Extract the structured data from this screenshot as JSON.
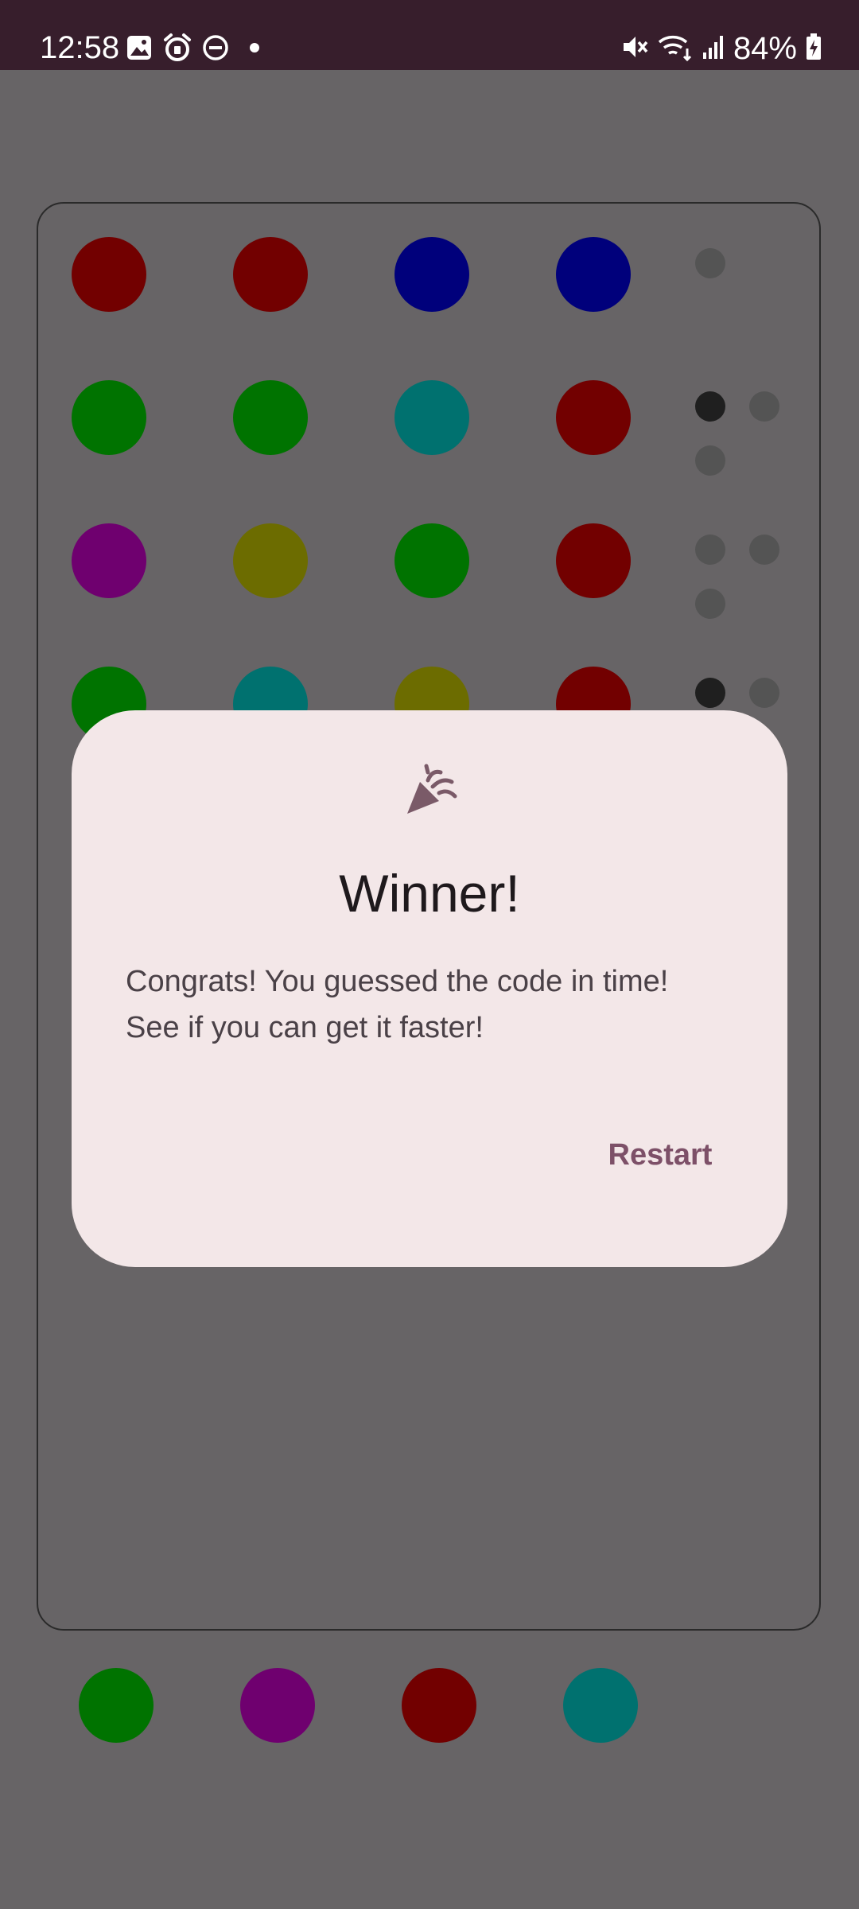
{
  "status_bar": {
    "time": "12:58",
    "battery": "84%",
    "left_icons": [
      "image-icon",
      "alarm-icon",
      "dnd-icon",
      "dot-icon"
    ],
    "right_icons": [
      "mute-icon",
      "wifi-icon",
      "signal-icon",
      "battery-icon"
    ]
  },
  "board": {
    "rows": [
      {
        "pegs": [
          "#720000",
          "#720000",
          "#00007b",
          "#00007b"
        ],
        "feedback": [
          "gray"
        ]
      },
      {
        "pegs": [
          "#007300",
          "#007300",
          "#00716f",
          "#720000"
        ],
        "feedback": [
          "black",
          "gray",
          "gray"
        ]
      },
      {
        "pegs": [
          "#6f006f",
          "#6c6c00",
          "#007300",
          "#720000"
        ],
        "feedback": [
          "gray",
          "gray",
          "gray"
        ]
      },
      {
        "pegs": [
          "#007300",
          "#00716f",
          "#6c6c00",
          "#720000"
        ],
        "feedback": [
          "black",
          "gray"
        ]
      }
    ]
  },
  "palette": [
    "#007300",
    "#6f006f",
    "#720000",
    "#00716f"
  ],
  "dialog": {
    "icon": "party-popper-icon",
    "title": "Winner!",
    "message_line1": "Congrats! You guessed the code in time!",
    "message_line2": "See if you can get it faster!",
    "button": "Restart"
  },
  "colors": {
    "scrim": "#676466",
    "status_bar_bg": "#371e2c",
    "dialog_bg": "#f3e7e8",
    "accent": "#7d5068",
    "feedback_black": "#1f1f1f",
    "feedback_gray": "#545454"
  }
}
